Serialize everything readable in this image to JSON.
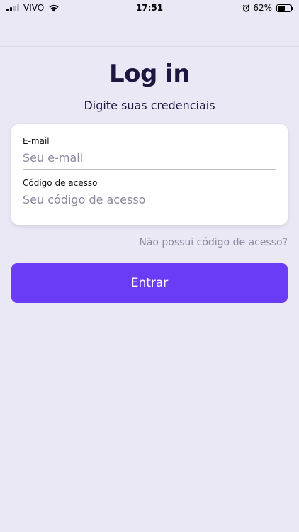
{
  "status_bar": {
    "carrier": "VIVO",
    "time": "17:51",
    "battery_percent": "62%",
    "battery_level": 0.62,
    "icons": [
      "signal-icon",
      "wifi-icon",
      "alarm-icon",
      "battery-icon"
    ]
  },
  "login": {
    "title": "Log in",
    "subtitle": "Digite suas credenciais",
    "email_label": "E-mail",
    "email_placeholder": "Seu e-mail",
    "email_value": "",
    "code_label": "Código de acesso",
    "code_placeholder": "Seu código de acesso",
    "code_value": "",
    "no_code_link": "Não possui código de acesso?",
    "submit_label": "Entrar"
  },
  "colors": {
    "background": "#E9E8F4",
    "primary": "#6B3CF5",
    "text_dark": "#1F1640",
    "placeholder": "#8C89A0"
  }
}
